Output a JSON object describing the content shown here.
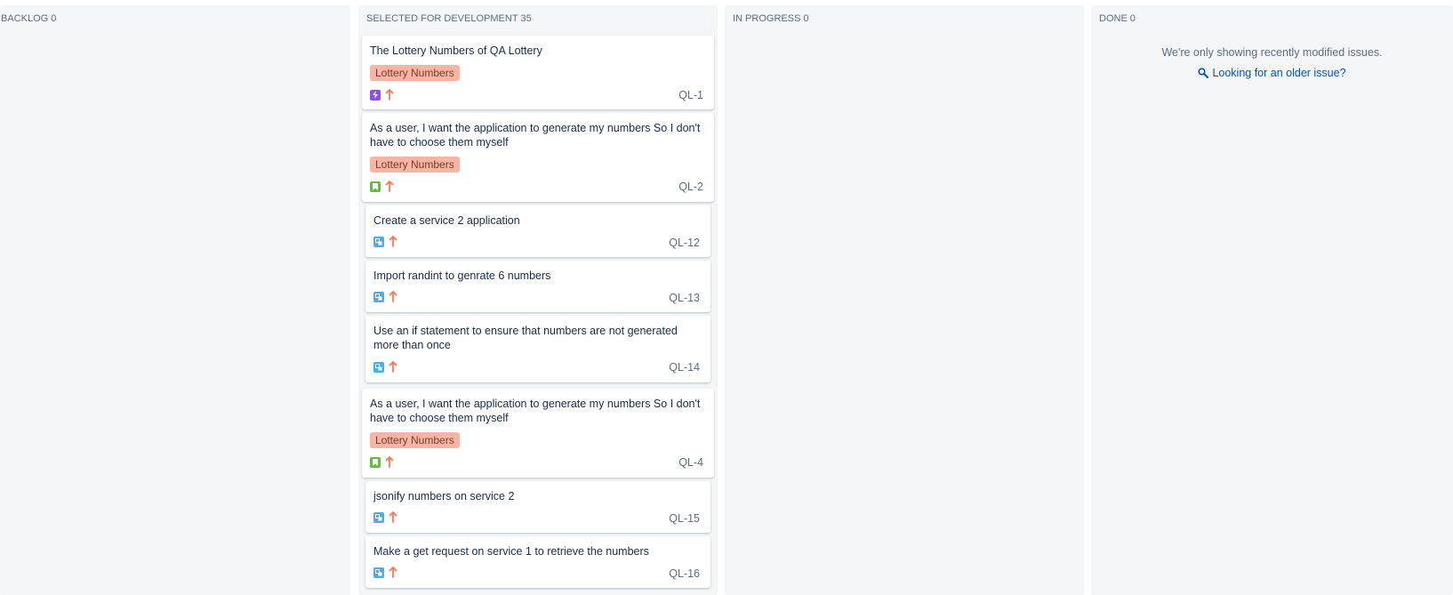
{
  "columns": {
    "backlog": {
      "title": "BACKLOG",
      "count": "0"
    },
    "selected": {
      "title": "SELECTED FOR DEVELOPMENT",
      "count": "35"
    },
    "in_progress": {
      "title": "IN PROGRESS",
      "count": "0"
    },
    "done": {
      "title": "DONE",
      "count": "0",
      "message": "We're only showing recently modified issues.",
      "link_label": "Looking for an older issue?"
    }
  },
  "cards": [
    {
      "title": "The Lottery Numbers of QA Lottery",
      "epic": "Lottery Numbers",
      "type": "epic-icon",
      "key": "QL-1"
    },
    {
      "title": "As a user, I want the application to generate my numbers So I don't have to choose them myself",
      "epic": "Lottery Numbers",
      "type": "story-icon",
      "key": "QL-2"
    },
    {
      "title": "Create a service 2 application",
      "type": "subtask-icon",
      "key": "QL-12"
    },
    {
      "title": "Import randint to genrate 6 numbers",
      "type": "subtask-icon",
      "key": "QL-13"
    },
    {
      "title": "Use an if statement to ensure that numbers are not generated more than once",
      "type": "subtask-icon",
      "key": "QL-14"
    },
    {
      "title": "As a user, I want the application to generate my numbers So I don't have to choose them myself",
      "epic": "Lottery Numbers",
      "type": "story-icon",
      "key": "QL-4"
    },
    {
      "title": "jsonify numbers on service 2",
      "type": "subtask-icon",
      "key": "QL-15"
    },
    {
      "title": "Make a get request on service 1 to retrieve the numbers",
      "type": "subtask-icon",
      "key": "QL-16"
    }
  ],
  "priority": {
    "name": "high-priority-arrow-icon",
    "color": "#ff7452"
  },
  "colors": {
    "epic": "#904ee2",
    "story": "#63ba3c",
    "subtask": "#4bade8",
    "epic_label_bg": "#f9b4a4",
    "link": "#0052cc"
  }
}
